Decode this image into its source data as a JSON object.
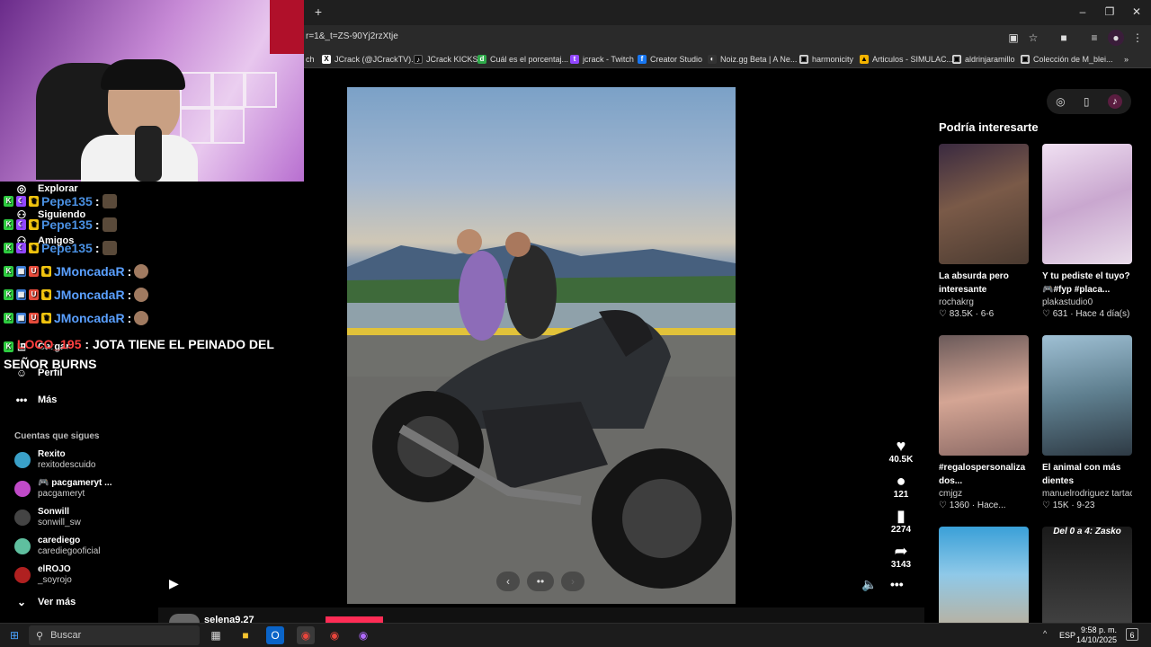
{
  "browser": {
    "url": "r=1&_t=ZS-90Yj2rzXtje",
    "new_tab": "+",
    "bookmarks": [
      {
        "label": "ch",
        "icon": ""
      },
      {
        "label": "JCrack (@JCrackTV)...",
        "icon": "x-logo-icon"
      },
      {
        "label": "JCrack KICKS",
        "icon": "tiktok-icon"
      },
      {
        "label": "Cuál es el porcentaj...",
        "icon": "green-icon"
      },
      {
        "label": "jcrack - Twitch",
        "icon": "twitch-icon"
      },
      {
        "label": "Creator Studio",
        "icon": "facebook-icon"
      },
      {
        "label": "Noiz.gg Beta | A Ne...",
        "icon": "noiz-icon"
      },
      {
        "label": "harmonicity",
        "icon": "bookmark-icon"
      },
      {
        "label": "Articulos - SIMULAC...",
        "icon": "drive-icon"
      },
      {
        "label": "aldrinjaramillo",
        "icon": "bookmark-icon"
      },
      {
        "label": "Colección de M_blei...",
        "icon": "bookmark-icon"
      }
    ],
    "bookmarks_more": "»"
  },
  "sidebar": {
    "items": [
      {
        "label": "Explorar",
        "icon": "compass-icon"
      },
      {
        "label": "Siguiendo",
        "icon": "following-icon"
      },
      {
        "label": "Amigos",
        "icon": "friends-icon"
      },
      {
        "label": "Cargar",
        "icon": "upload-icon"
      },
      {
        "label": "Perfil",
        "icon": "profile-icon"
      },
      {
        "label": "Más",
        "icon": "more-icon"
      }
    ],
    "following_heading": "Cuentas que sigues",
    "accounts": [
      {
        "name": "Rexito",
        "handle": "rexitodescuido",
        "color": "#3aa0c8"
      },
      {
        "name": "🎮 pacgameryt ...",
        "handle": "pacgameryt",
        "color": "#c04ac8"
      },
      {
        "name": "Sonwill",
        "handle": "sonwill_sw",
        "color": "#444444"
      },
      {
        "name": "carediego",
        "handle": "carediegooficial",
        "color": "#5fbf9f"
      },
      {
        "name": "elROJO",
        "handle": "_soyrojo",
        "color": "#b02020"
      }
    ],
    "see_more": "Ver más"
  },
  "chat": [
    {
      "user": "Pepe135",
      "color": "#4a90e2",
      "text": ""
    },
    {
      "user": "Pepe135",
      "color": "#4a90e2",
      "text": ""
    },
    {
      "user": "Pepe135",
      "color": "#4a90e2",
      "text": ""
    },
    {
      "user": "JMoncadaR",
      "color": "#5aa0ff",
      "text": ""
    },
    {
      "user": "JMoncadaR",
      "color": "#5aa0ff",
      "text": ""
    },
    {
      "user": "JMoncadaR",
      "color": "#5aa0ff",
      "text": ""
    },
    {
      "user": "LOCO_195",
      "color": "#ff4040",
      "text": "JOTA TIENE EL PEINADO DEL SEÑOR BURNS"
    }
  ],
  "actions": {
    "likes": "40.5K",
    "comments": "121",
    "saves": "2274",
    "shares": "3143"
  },
  "carousel": {
    "prev": "‹",
    "dots": "••",
    "next": "›"
  },
  "comment_user": "selena9.27",
  "right_panel": {
    "title": "Podría interesarte",
    "cards": [
      {
        "caption": "La absurda pero interesante máquin...",
        "author": "rochakrg",
        "stats": "♡ 83.5K · 6-6",
        "thumb": "#5a4638"
      },
      {
        "caption": "Y tu pediste el tuyo? 🎮#fyp #placa...",
        "author": "plakastudio0",
        "stats": "♡ 631 · Hace 4 día(s)",
        "thumb": "#d9c3dd"
      },
      {
        "caption": "#regalospersonaliza dos...",
        "author": "cmjgz",
        "stats": "♡ 1360 · Hace...",
        "thumb": "#c99b8c"
      },
      {
        "caption": "El animal con más dientes",
        "author": "manuelrodriguez tartac",
        "stats": "♡ 15K · 9-23",
        "thumb": "#8aa7ba"
      },
      {
        "caption": "",
        "author": "",
        "stats": "",
        "thumb": "#2e8fb8"
      },
      {
        "caption": "",
        "author": "",
        "stats": "",
        "thumb": "#2a2a2a",
        "overlay": "Del 0 a 4: Zasko"
      }
    ]
  },
  "taskbar": {
    "search_placeholder": "Buscar",
    "lang": "ESP",
    "time": "9:58 p. m.",
    "date": "14/10/2025",
    "notif": "6"
  }
}
